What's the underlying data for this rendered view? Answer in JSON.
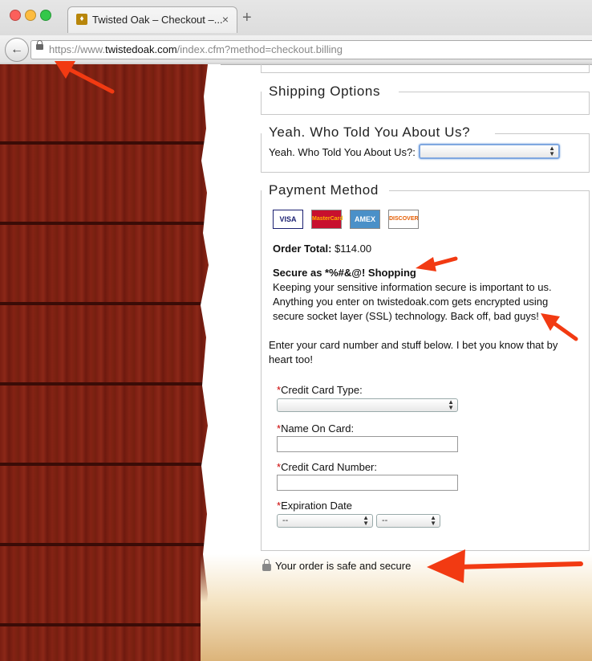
{
  "browser": {
    "tab_title": "Twisted Oak – Checkout –...",
    "url_scheme": "https://www.",
    "url_domain": "twistedoak.com",
    "url_path": "/index.cfm?method=checkout.billing"
  },
  "sections": {
    "shipping_title": "Shipping Options",
    "who_title": "Yeah. Who Told You About Us?",
    "who_label": "Yeah. Who Told You About Us?:",
    "payment_title": "Payment Method"
  },
  "cards": [
    "VISA",
    "MasterCard",
    "AMEX",
    "DISCOVER"
  ],
  "order": {
    "total_label": "Order Total:",
    "total_value": "$114.00"
  },
  "secure_note": {
    "heading": "Secure as *%#&@! Shopping",
    "line1": "Keeping your sensitive information secure is important to us.",
    "line2": "Anything you enter on twistedoak.com gets encrypted using",
    "line3": "secure socket layer (SSL) technology. Back off, bad guys!"
  },
  "instructions": {
    "line1": "Enter your card number and stuff below. I bet you know that by",
    "line2": "heart too!"
  },
  "form": {
    "required_mark": "*",
    "card_type_label": "Credit Card Type:",
    "name_label": "Name On Card:",
    "number_label": "Credit Card Number:",
    "expiration_label": "Expiration Date",
    "exp_month_value": "--",
    "exp_year_value": "--"
  },
  "footer": {
    "safe_text": "Your order is safe and secure"
  },
  "colors": {
    "annotation_arrow": "#f23a12",
    "required": "#cc0000",
    "wood": "#7a1e12"
  }
}
